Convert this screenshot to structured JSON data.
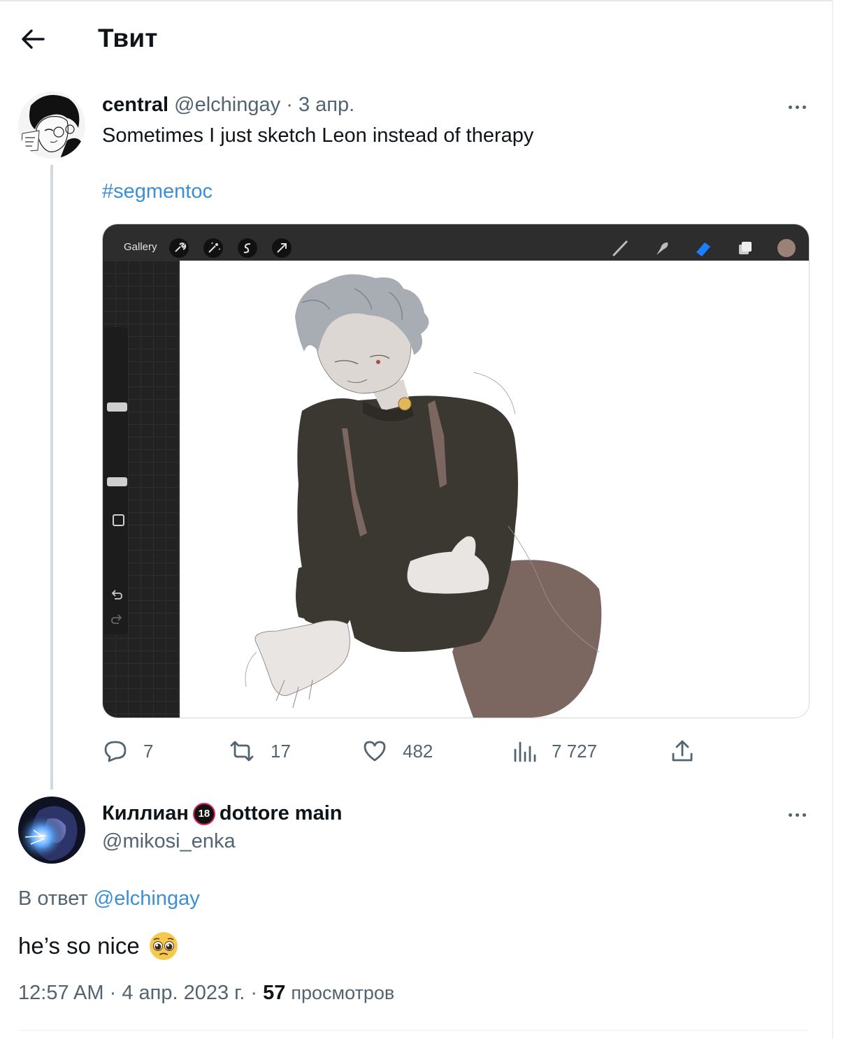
{
  "header": {
    "title": "Твит"
  },
  "main_tweet": {
    "name": "central",
    "handle": "@elchingay",
    "separator": "·",
    "time": "3 апр.",
    "text": "Sometimes I just sketch Leon instead of therapy",
    "hashtag": "#segmentoc",
    "media": {
      "gallery_label": "Gallery"
    },
    "actions": {
      "replies": "7",
      "retweets": "17",
      "likes": "482",
      "views": "7 727"
    }
  },
  "reply_tweet": {
    "name_part1": "Киллиан",
    "badge": "18",
    "name_part2": "dottore main",
    "handle": "@mikosi_enka",
    "reply_prefix": "В ответ",
    "reply_to_handle": "@elchingay",
    "text": "he’s so nice",
    "emoji": "pleading-face",
    "time": "12:57 AM",
    "dot1": "·",
    "date": "4 апр. 2023 г.",
    "dot2": "·",
    "views_count": "57",
    "views_label": "просмотров"
  },
  "colors": {
    "link": "#3b8fd4",
    "secondary_text": "#536471",
    "thread_line": "#cfd9de"
  }
}
